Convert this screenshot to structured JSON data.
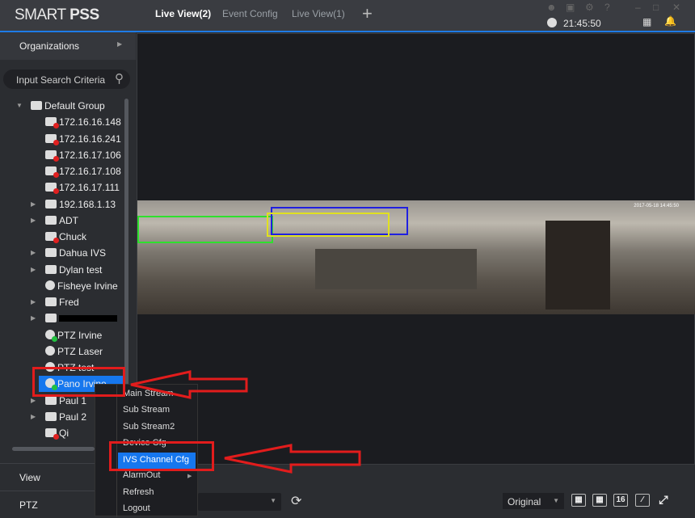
{
  "app": {
    "logo_light": "SMART ",
    "logo_bold": "PSS",
    "clock": "21:45:50"
  },
  "tabs": [
    {
      "label": "Live View(2)"
    },
    {
      "label": "Event Config"
    },
    {
      "label": "Live View(1)"
    }
  ],
  "sidebar": {
    "organizations": "Organizations",
    "search_placeholder": "Input Search Criteria",
    "tree": [
      {
        "label": "Default Group"
      },
      {
        "label": "172.16.16.148"
      },
      {
        "label": "172.16.16.241"
      },
      {
        "label": "172.16.17.106"
      },
      {
        "label": "172.16.17.108"
      },
      {
        "label": "172.16.17.111"
      },
      {
        "label": "192.168.1.13"
      },
      {
        "label": "ADT"
      },
      {
        "label": "Chuck"
      },
      {
        "label": "Dahua IVS"
      },
      {
        "label": "Dylan test"
      },
      {
        "label": "Fisheye Irvine"
      },
      {
        "label": "Fred"
      },
      {
        "label": ""
      },
      {
        "label": "PTZ Irvine"
      },
      {
        "label": "PTZ Laser"
      },
      {
        "label": "PTZ test"
      },
      {
        "label": "Pano Irvine"
      },
      {
        "label": "Paul 1"
      },
      {
        "label": "Paul 2"
      },
      {
        "label": "Qi"
      }
    ],
    "view": "View",
    "ptz": "PTZ"
  },
  "context_menu": [
    "Main Stream",
    "Sub Stream",
    "Sub Stream2",
    "Device Cfg",
    "IVS Channel Cfg",
    "AlarmOut",
    "Refresh",
    "Logout"
  ],
  "toolbar": {
    "ratio": "Original",
    "grid16": "16"
  },
  "video": {
    "timestamp": "2017-05-18 14:45:50"
  }
}
